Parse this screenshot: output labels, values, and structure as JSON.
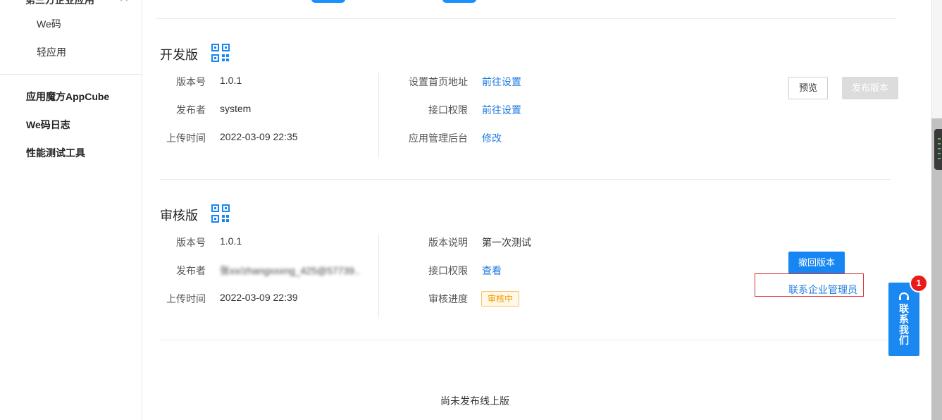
{
  "sidebar": {
    "cut_item": "第三方企业应用",
    "sub_items": [
      "We码",
      "轻应用"
    ],
    "items": [
      "应用魔方AppCube",
      "We码日志",
      "性能测试工具"
    ]
  },
  "dev": {
    "title": "开发版",
    "left": [
      {
        "label": "版本号",
        "value": "1.0.1"
      },
      {
        "label": "发布者",
        "value": "system"
      },
      {
        "label": "上传时间",
        "value": "2022-03-09 22:35"
      }
    ],
    "right": [
      {
        "label": "设置首页地址",
        "value": "前往设置"
      },
      {
        "label": "接口权限",
        "value": "前往设置"
      },
      {
        "label": "应用管理后台",
        "value": "修改"
      }
    ],
    "preview_label": "预览",
    "publish_label": "发布版本"
  },
  "review": {
    "title": "审核版",
    "left": [
      {
        "label": "版本号",
        "value": "1.0.1"
      },
      {
        "label": "发布者",
        "value": "张xx/zhangxxxng_425@57739..."
      },
      {
        "label": "上传时间",
        "value": "2022-03-09 22:39"
      }
    ],
    "right": [
      {
        "label": "版本说明",
        "value": "第一次测试"
      },
      {
        "label": "接口权限",
        "value": "查看"
      },
      {
        "label": "审核进度",
        "value": "审核中"
      }
    ],
    "withdraw_label": "撤回版本",
    "contact_admin": "联系企业管理员"
  },
  "online": {
    "empty_text": "尚未发布线上版"
  },
  "float_contact": {
    "label": "联系我们",
    "badge": "1"
  },
  "colors": {
    "link": "#1f7ae0",
    "primary": "#1786f3",
    "pending_tag": "#f09b00",
    "badge": "#e81b1b",
    "highlight_border": "#d9302e"
  }
}
